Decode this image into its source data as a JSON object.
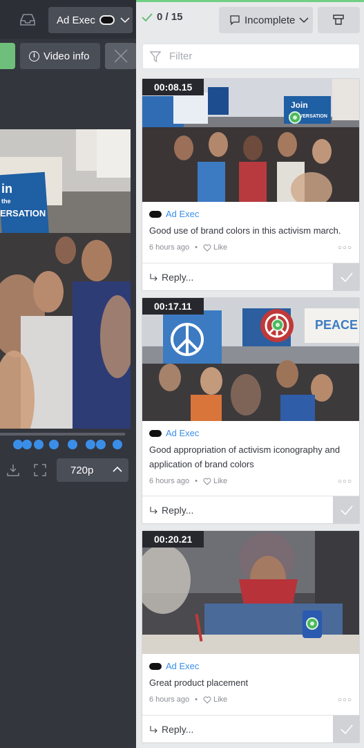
{
  "left_panel": {
    "user_menu": {
      "label": "Ad Exec"
    },
    "video_info_label": "Video info",
    "quality_label": "720p"
  },
  "right_panel": {
    "comment_count": "0 / 15",
    "status_filter": "Incomplete",
    "filter_placeholder": "Filter",
    "comments": [
      {
        "timecode": "00:08.15",
        "author": "Ad Exec",
        "text": "Good use of brand colors in this activism march.",
        "time_ago": "6 hours ago",
        "like_label": "Like",
        "reply_label": "Reply..."
      },
      {
        "timecode": "00:17.11",
        "author": "Ad Exec",
        "text": "Good appropriation of activism iconography and application of brand colors",
        "time_ago": "6 hours ago",
        "like_label": "Like",
        "reply_label": "Reply..."
      },
      {
        "timecode": "00:20.21",
        "author": "Ad Exec",
        "text": "Great product placement",
        "time_ago": "6 hours ago",
        "like_label": "Like",
        "reply_label": "Reply..."
      }
    ]
  },
  "colors": {
    "accent_green": "#6fcf83",
    "link_blue": "#3a8ee8",
    "panel_dark": "#33363d"
  },
  "icons": [
    "inbox-icon",
    "chevron-down-icon",
    "info-icon",
    "close-icon",
    "download-icon",
    "fullscreen-icon",
    "chevron-up-icon",
    "check-icon",
    "comment-icon",
    "actions-icon",
    "filter-icon",
    "heart-icon",
    "reply-icon",
    "more-icon"
  ]
}
